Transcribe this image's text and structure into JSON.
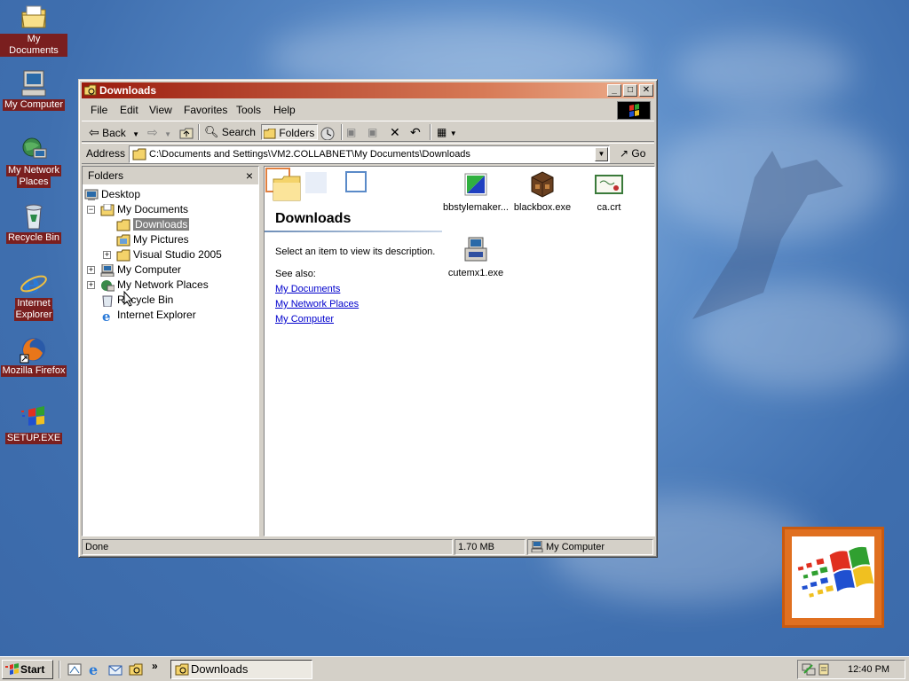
{
  "desktop": {
    "icons": [
      {
        "label": "My Documents",
        "icon": "my-documents-icon"
      },
      {
        "label": "My Computer",
        "icon": "my-computer-icon"
      },
      {
        "label_line1": "My Network",
        "label_line2": "Places",
        "icon": "network-places-icon"
      },
      {
        "label": "Recycle Bin",
        "icon": "recycle-bin-icon"
      },
      {
        "label_line1": "Internet",
        "label_line2": "Explorer",
        "icon": "internet-explorer-icon"
      },
      {
        "label": "Mozilla Firefox",
        "icon": "firefox-icon"
      },
      {
        "label": "SETUP.EXE",
        "icon": "setup-icon"
      }
    ]
  },
  "window": {
    "title": "Downloads",
    "controls": {
      "minimize": "_",
      "maximize": "□",
      "close": "✕"
    },
    "menu": [
      "File",
      "Edit",
      "View",
      "Favorites",
      "Tools",
      "Help"
    ],
    "toolbar": {
      "back": "Back",
      "search": "Search",
      "folders": "Folders"
    },
    "address": {
      "label": "Address",
      "value": "C:\\Documents and Settings\\VM2.COLLABNET\\My Documents\\Downloads",
      "go": "Go"
    },
    "folders_pane": {
      "title": "Folders",
      "close": "×",
      "tree": [
        {
          "label": "Desktop"
        },
        {
          "label": "My Documents",
          "expander": "−"
        },
        {
          "label": "Downloads"
        },
        {
          "label": "My Pictures"
        },
        {
          "label": "Visual Studio 2005",
          "expander": "+"
        },
        {
          "label": "My Computer",
          "expander": "+"
        },
        {
          "label": "My Network Places",
          "expander": "+"
        },
        {
          "label": "Recycle Bin"
        },
        {
          "label": "Internet Explorer"
        }
      ]
    },
    "content": {
      "heading": "Downloads",
      "description": "Select an item to view its description.",
      "see_also": "See also:",
      "links": [
        "My Documents",
        "My Network Places",
        "My Computer"
      ],
      "files": [
        {
          "name": "bbstylemaker...",
          "icon": "bbstylemaker-icon"
        },
        {
          "name": "blackbox.exe",
          "icon": "blackbox-icon"
        },
        {
          "name": "ca.crt",
          "icon": "certificate-icon"
        },
        {
          "name": "cutemx1.exe",
          "icon": "installer-icon"
        }
      ]
    },
    "status": {
      "text": "Done",
      "size": "1.70 MB",
      "zone": "My Computer"
    }
  },
  "taskbar": {
    "start": "Start",
    "task": "Downloads",
    "clock": "12:40 PM",
    "chevron": "»"
  }
}
